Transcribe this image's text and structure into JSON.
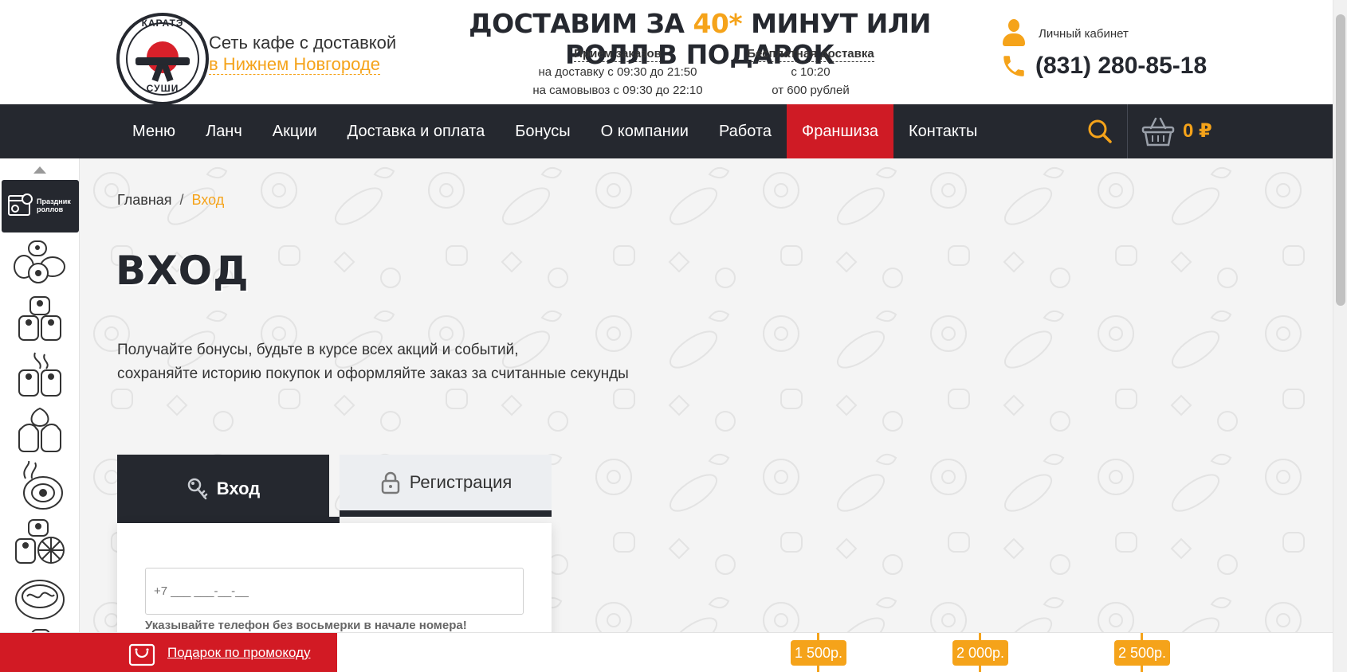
{
  "header": {
    "logo_top": "КАРАТЭ",
    "logo_bottom": "СУШИ",
    "tagline": "Сеть кафе с доставкой",
    "city": "в Нижнем Новгороде",
    "promo_part1": "Доставим за ",
    "promo_highlight": "40*",
    "promo_part2": " минут или ролл в подарок",
    "orders": {
      "title": "Прием заказов",
      "line1": "на доставку с 09:30 до 21:50",
      "line2": "на самовывоз с 09:30 до 22:10"
    },
    "free_delivery": {
      "title": "Бесплатная доставка",
      "line1": "с 10:20",
      "line2": "от 600 рублей"
    },
    "account_label": "Личный кабинет",
    "phone": "(831) 280-85-18"
  },
  "nav": {
    "items": [
      "Меню",
      "Ланч",
      "Акции",
      "Доставка и оплата",
      "Бонусы",
      "О компании",
      "Работа",
      "Франшиза",
      "Контакты"
    ],
    "cart_total": "0 ₽"
  },
  "sidebar": {
    "holiday_label": "Праздник роллов",
    "categories": [
      "sushi-set-icon",
      "rolls-icon",
      "hot-rolls-icon",
      "baked-rolls-icon",
      "tempura-icon",
      "lemon-rolls-icon",
      "noodles-icon"
    ]
  },
  "breadcrumb": {
    "home": "Главная",
    "separator": "/",
    "current": "Вход"
  },
  "page": {
    "title": "Вход",
    "intro_line1": "Получайте бонусы, будьте в курсе всех акций и событий,",
    "intro_line2": "сохраняйте историю покупок и оформляйте заказ за считанные секунды"
  },
  "tabs": {
    "login": "Вход",
    "register": "Регистрация"
  },
  "form": {
    "phone_placeholder": "+7 ___ ___-__-__",
    "phone_hint": "Указывайте телефон без восьмерки в начале номера!"
  },
  "bottom": {
    "promo_label": "Подарок по промокоду",
    "thresholds": [
      "1 500р.",
      "2 000р.",
      "2 500р."
    ]
  },
  "colors": {
    "accent": "#f5a31a",
    "dark": "#25282f",
    "red": "#cf1b25"
  }
}
